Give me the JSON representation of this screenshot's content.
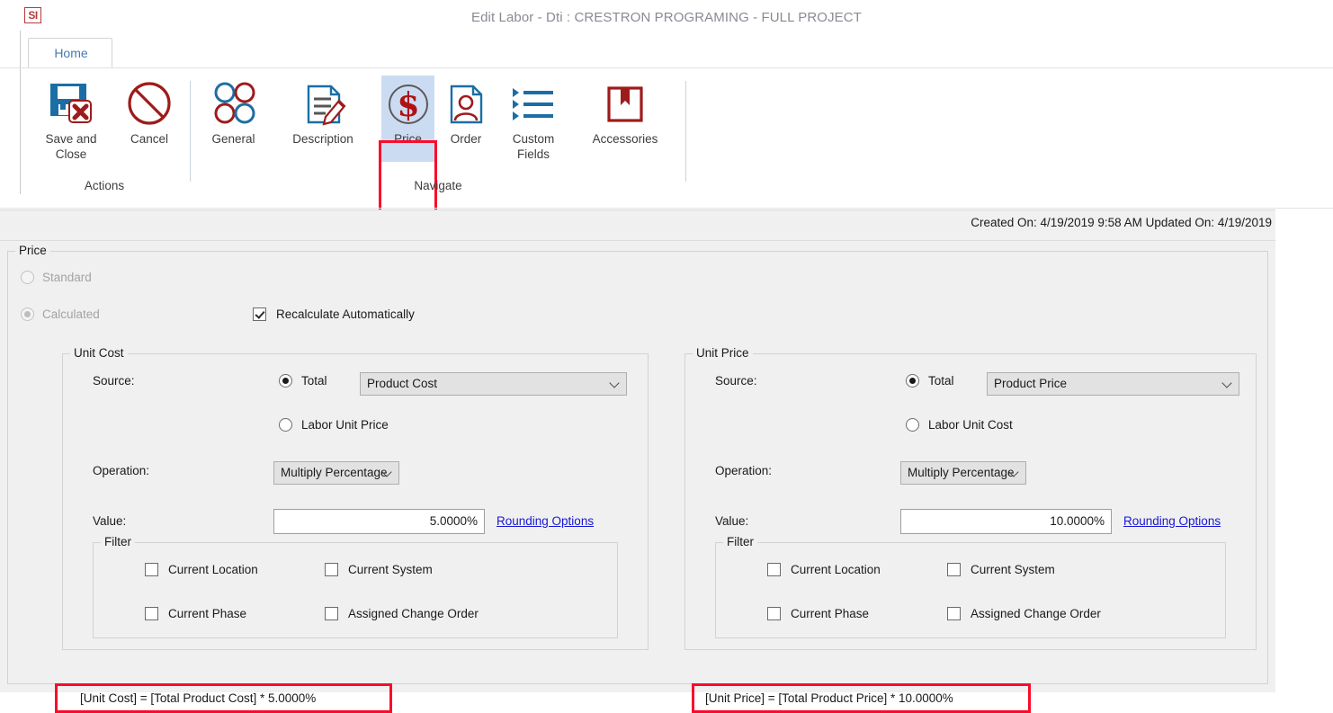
{
  "window": {
    "app_badge": "SI",
    "title": "Edit Labor - Dti : CRESTRON PROGRAMING - FULL PROJECT"
  },
  "tabs": [
    {
      "label": "Home",
      "selected": true
    }
  ],
  "ribbon": {
    "groups": [
      {
        "label": "Actions"
      },
      {
        "label": "Navigate"
      }
    ],
    "buttons": [
      {
        "name": "save-and-close",
        "label_line1": "Save and",
        "label_line2": "Close",
        "icon": "save-close-icon"
      },
      {
        "name": "cancel",
        "label_line1": "Cancel",
        "label_line2": "",
        "icon": "cancel-icon"
      },
      {
        "name": "general",
        "label_line1": "General",
        "label_line2": "",
        "icon": "general-circles-icon"
      },
      {
        "name": "description",
        "label_line1": "Description",
        "label_line2": "",
        "icon": "description-pencil-icon"
      },
      {
        "name": "price",
        "label_line1": "Price",
        "label_line2": "",
        "icon": "price-dollar-icon",
        "selected": true,
        "highlighted": true
      },
      {
        "name": "order",
        "label_line1": "Order",
        "label_line2": "",
        "icon": "order-person-icon"
      },
      {
        "name": "custom-fields",
        "label_line1": "Custom",
        "label_line2": "Fields",
        "icon": "custom-fields-list-icon"
      },
      {
        "name": "accessories",
        "label_line1": "Accessories",
        "label_line2": "",
        "icon": "accessories-box-icon"
      }
    ]
  },
  "meta": {
    "text": "Created On: 4/19/2019 9:58 AM  Updated On: 4/19/2019"
  },
  "price_section": {
    "title": "Price",
    "standard_label": "Standard",
    "calculated_label": "Calculated",
    "standard_selected": false,
    "calculated_selected": true,
    "recalculate_label": "Recalculate Automatically",
    "recalculate_checked": true
  },
  "unit_cost": {
    "title": "Unit Cost",
    "source_label": "Source:",
    "total_label": "Total",
    "total_selected": true,
    "source_value": "Product Cost",
    "alt_source_label": "Labor Unit Price",
    "alt_source_selected": false,
    "operation_label": "Operation:",
    "operation_value": "Multiply Percentage",
    "value_label": "Value:",
    "value": "5.0000%",
    "rounding_link": "Rounding Options",
    "filter": {
      "title": "Filter",
      "items": [
        {
          "label": "Current Location",
          "checked": false
        },
        {
          "label": "Current System",
          "checked": false
        },
        {
          "label": "Current Phase",
          "checked": false
        },
        {
          "label": "Assigned Change Order",
          "checked": false
        }
      ]
    },
    "formula": "[Unit Cost] = [Total Product Cost] * 5.0000%"
  },
  "unit_price": {
    "title": "Unit Price",
    "source_label": "Source:",
    "total_label": "Total",
    "total_selected": true,
    "source_value": "Product Price",
    "alt_source_label": "Labor Unit Cost",
    "alt_source_selected": false,
    "operation_label": "Operation:",
    "operation_value": "Multiply Percentage",
    "value_label": "Value:",
    "value": "10.0000%",
    "rounding_link": "Rounding Options",
    "filter": {
      "title": "Filter",
      "items": [
        {
          "label": "Current Location",
          "checked": false
        },
        {
          "label": "Current System",
          "checked": false
        },
        {
          "label": "Current Phase",
          "checked": false
        },
        {
          "label": "Assigned Change Order",
          "checked": false
        }
      ]
    },
    "formula": "[Unit Price] = [Total Product Price] * 10.0000%"
  },
  "colors": {
    "accent_blue": "#1b6ea5",
    "accent_red": "#9e1b1b",
    "annotation_red": "#fb0b2a",
    "selection_blue": "#cbdcf2",
    "link_blue": "#1717d6",
    "tab_text": "#4a77b4"
  }
}
